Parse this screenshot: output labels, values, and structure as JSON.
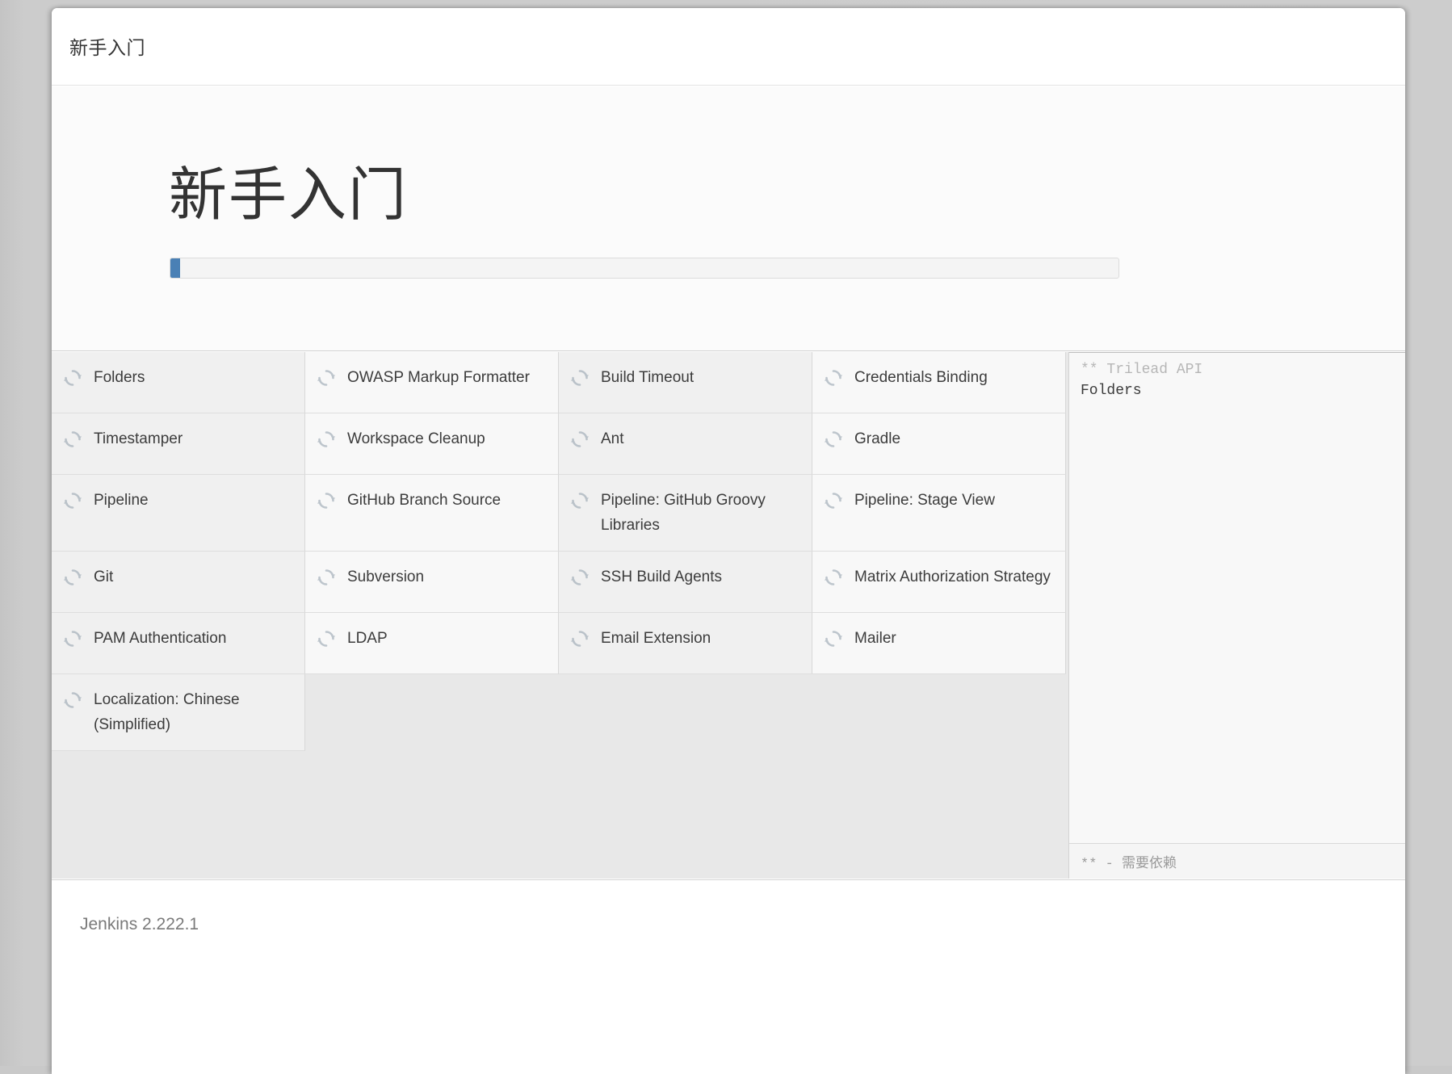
{
  "window": {
    "header_title": "新手入门"
  },
  "hero": {
    "title": "新手入门",
    "progress_percent": 1,
    "progress_fill_color": "#4a80b5"
  },
  "plugins": {
    "rows": [
      [
        {
          "label": "Folders",
          "icon": "spinner-icon"
        },
        {
          "label": "OWASP Markup Formatter",
          "icon": "spinner-icon"
        },
        {
          "label": "Build Timeout",
          "icon": "spinner-icon"
        },
        {
          "label": "Credentials Binding",
          "icon": "spinner-icon"
        }
      ],
      [
        {
          "label": "Timestamper",
          "icon": "spinner-icon"
        },
        {
          "label": "Workspace Cleanup",
          "icon": "spinner-icon"
        },
        {
          "label": "Ant",
          "icon": "spinner-icon"
        },
        {
          "label": "Gradle",
          "icon": "spinner-icon"
        }
      ],
      [
        {
          "label": "Pipeline",
          "icon": "spinner-icon"
        },
        {
          "label": "GitHub Branch Source",
          "icon": "spinner-icon"
        },
        {
          "label": "Pipeline: GitHub Groovy Libraries",
          "icon": "spinner-icon"
        },
        {
          "label": "Pipeline: Stage View",
          "icon": "spinner-icon"
        }
      ],
      [
        {
          "label": "Git",
          "icon": "spinner-icon"
        },
        {
          "label": "Subversion",
          "icon": "spinner-icon"
        },
        {
          "label": "SSH Build Agents",
          "icon": "spinner-icon"
        },
        {
          "label": "Matrix Authorization Strategy",
          "icon": "spinner-icon"
        }
      ],
      [
        {
          "label": "PAM Authentication",
          "icon": "spinner-icon"
        },
        {
          "label": "LDAP",
          "icon": "spinner-icon"
        },
        {
          "label": "Email Extension",
          "icon": "spinner-icon"
        },
        {
          "label": "Mailer",
          "icon": "spinner-icon"
        }
      ],
      [
        {
          "label": "Localization: Chinese (Simplified)",
          "icon": "spinner-icon"
        }
      ]
    ]
  },
  "log": {
    "lines": [
      {
        "text": "** Trilead API",
        "kind": "dep"
      },
      {
        "text": "Folders",
        "kind": "main"
      }
    ],
    "footnote": "**  -  需要依赖"
  },
  "footer": {
    "version": "Jenkins 2.222.1"
  }
}
